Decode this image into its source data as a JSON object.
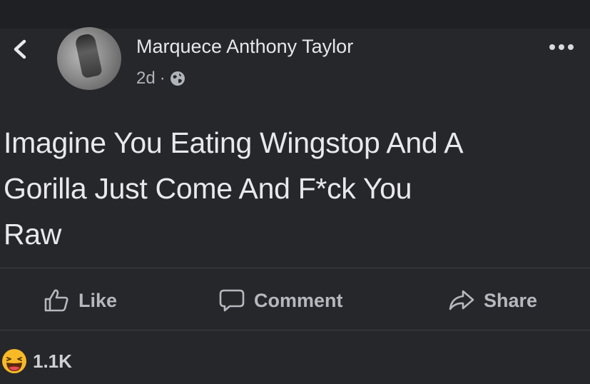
{
  "post": {
    "author": "Marquece Anthony Taylor",
    "time": "2d",
    "separator": "·",
    "lines": [
      "Imagine You Eating Wingstop And A",
      "Gorilla Just Come And F*ck You",
      "Raw"
    ]
  },
  "actions": {
    "like_label": "Like",
    "comment_label": "Comment",
    "share_label": "Share"
  },
  "reactions": {
    "count": "1.1K",
    "emoji": "laughing-emoji-icon"
  },
  "icons": {
    "back": "chevron-left-icon",
    "privacy": "globe-icon",
    "more": "more-options-icon"
  },
  "colors": {
    "background": "#26272b",
    "text": "#e4e6eb",
    "muted": "#b0b3b8",
    "emoji_yellow": "#f7b928"
  }
}
